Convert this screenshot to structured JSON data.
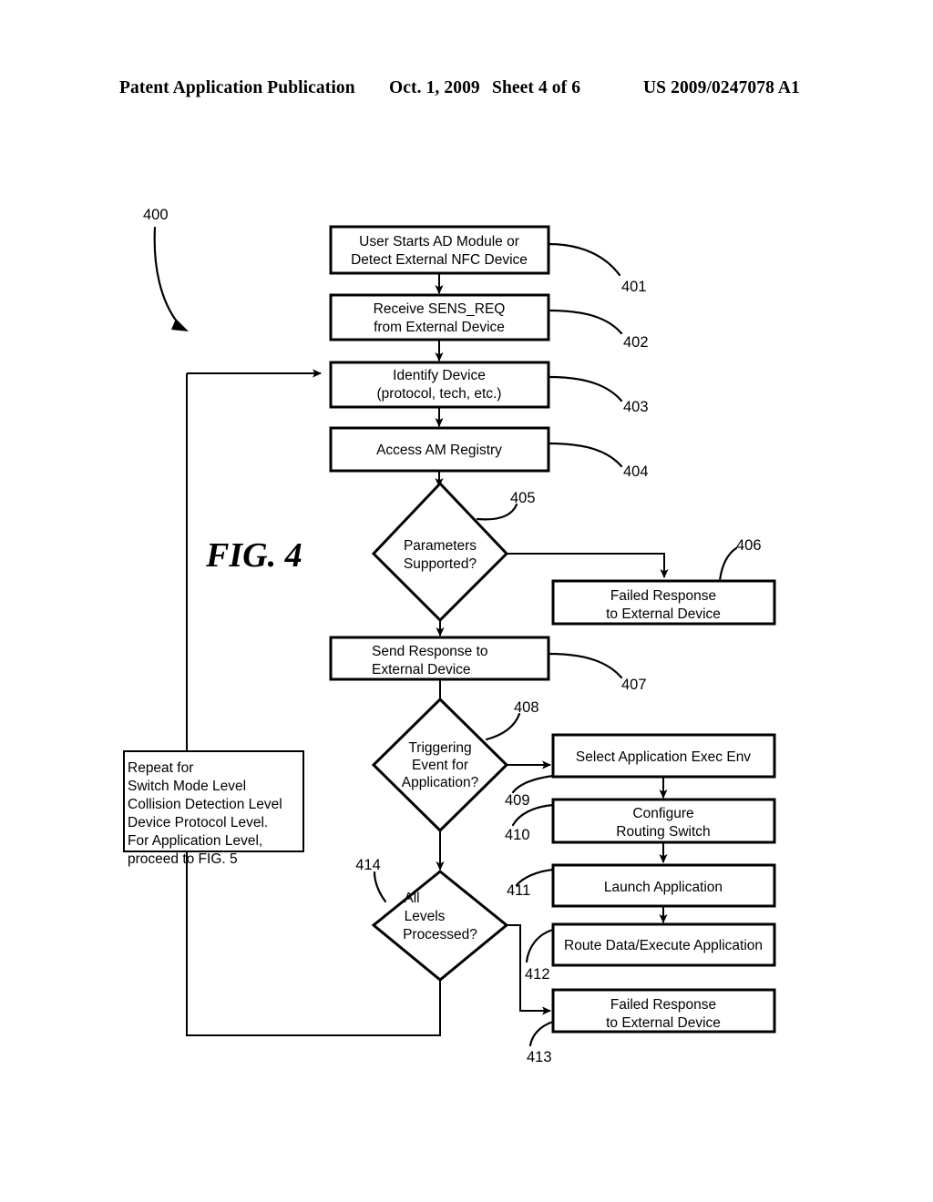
{
  "header": {
    "publication": "Patent Application Publication",
    "date": "Oct. 1, 2009",
    "sheet": "Sheet 4 of 6",
    "patent_number": "US 2009/0247078 A1"
  },
  "figure": {
    "label": "FIG. 4",
    "diagram_ref": "400"
  },
  "nodes": {
    "n401": {
      "ref": "401",
      "line1": "User Starts AD Module or",
      "line2": "Detect External NFC Device",
      "shape": "process"
    },
    "n402": {
      "ref": "402",
      "line1": "Receive SENS_REQ",
      "line2": "from External Device",
      "shape": "process"
    },
    "n403": {
      "ref": "403",
      "line1": "Identify Device",
      "line2": "(protocol, tech, etc.)",
      "shape": "process"
    },
    "n404": {
      "ref": "404",
      "line1": "Access AM Registry",
      "line2": "",
      "shape": "process"
    },
    "n405": {
      "ref": "405",
      "line1": "Parameters",
      "line2": "Supported?",
      "shape": "decision"
    },
    "n406": {
      "ref": "406",
      "line1": "Failed Response",
      "line2": "to External Device",
      "shape": "process"
    },
    "n407": {
      "ref": "407",
      "line1": "Send Response to",
      "line2": "External Device",
      "shape": "process"
    },
    "n408": {
      "ref": "408",
      "line1": "Triggering",
      "line2": "Event for",
      "line3": "Application?",
      "shape": "decision"
    },
    "n409": {
      "ref": "409",
      "line1": "Select Application Exec Env",
      "line2": "",
      "shape": "process"
    },
    "n410": {
      "ref": "410",
      "line1": "Configure",
      "line2": "Routing Switch",
      "shape": "process"
    },
    "n411": {
      "ref": "411",
      "line1": "Launch Application",
      "line2": "",
      "shape": "process"
    },
    "n412": {
      "ref": "412",
      "line1": "Route Data/Execute Application",
      "line2": "",
      "shape": "process"
    },
    "n413": {
      "ref": "413",
      "line1": "Failed Response",
      "line2": "to External Device",
      "shape": "process"
    },
    "n414": {
      "ref": "414",
      "line1": "All",
      "line2": "Levels",
      "line3": "Processed?",
      "shape": "decision"
    }
  },
  "note": {
    "lines": [
      "Repeat for",
      "Switch Mode Level",
      "Collision Detection Level",
      "Device Protocol Level.",
      "For Application Level,",
      "proceed to FIG. 5"
    ]
  },
  "colors": {
    "ink": "#000000",
    "paper": "#ffffff"
  }
}
